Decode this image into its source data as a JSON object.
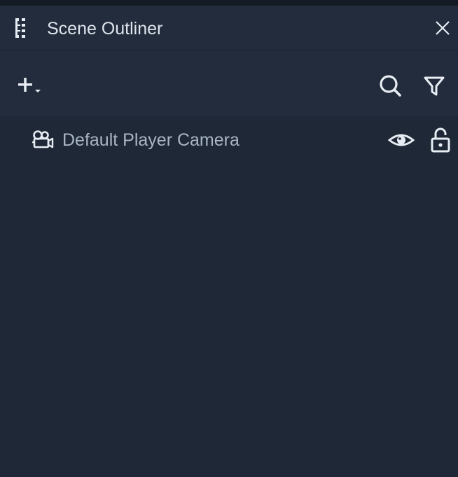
{
  "panel": {
    "title": "Scene Outliner",
    "icons": {
      "outliner": "outliner-tree-icon",
      "close": "close-icon"
    }
  },
  "toolbar": {
    "add_icon": "add-dropdown-icon",
    "search_icon": "search-icon",
    "filter_icon": "filter-icon"
  },
  "tree": {
    "items": [
      {
        "label": "Default Player Camera",
        "icon": "camera-icon",
        "visible": true,
        "locked": false
      }
    ]
  },
  "colors": {
    "background": "#1e2836",
    "header": "#222c3c",
    "title_text": "#dfe4ec",
    "item_text": "#a9b4c4",
    "icon": "#e8edf4"
  }
}
